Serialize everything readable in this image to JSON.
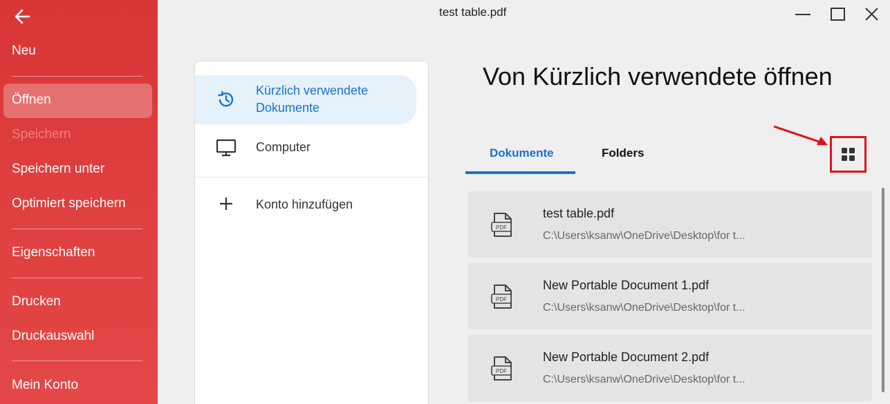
{
  "window": {
    "title": "test table.pdf"
  },
  "sidebar": {
    "items": [
      {
        "label": "Neu"
      },
      {
        "label": "Öffnen"
      },
      {
        "label": "Speichern"
      },
      {
        "label": "Speichern unter"
      },
      {
        "label": "Optimiert speichern"
      },
      {
        "label": "Eigenschaften"
      },
      {
        "label": "Drucken"
      },
      {
        "label": "Druckauswahl"
      },
      {
        "label": "Mein Konto"
      }
    ]
  },
  "locations": {
    "recent_line1": "Kürzlich verwendete",
    "recent_line2": "Dokumente",
    "computer": "Computer",
    "add_account": "Konto hinzufügen"
  },
  "main": {
    "heading": "Von Kürzlich verwendete öffnen",
    "tabs": [
      {
        "label": "Dokumente"
      },
      {
        "label": "Folders"
      }
    ],
    "files": [
      {
        "name": "test table.pdf",
        "path": "C:\\Users\\ksanw\\OneDrive\\Desktop\\for t...",
        "icon_text": "PDF"
      },
      {
        "name": "New Portable Document 1.pdf",
        "path": "C:\\Users\\ksanw\\OneDrive\\Desktop\\for t...",
        "icon_text": "PDF"
      },
      {
        "name": "New Portable Document 2.pdf",
        "path": "C:\\Users\\ksanw\\OneDrive\\Desktop\\for t...",
        "icon_text": "PDF"
      }
    ]
  },
  "colors": {
    "accent": "#1a73c9",
    "sidebar": "#d93636",
    "highlight_box": "#e0101a"
  }
}
